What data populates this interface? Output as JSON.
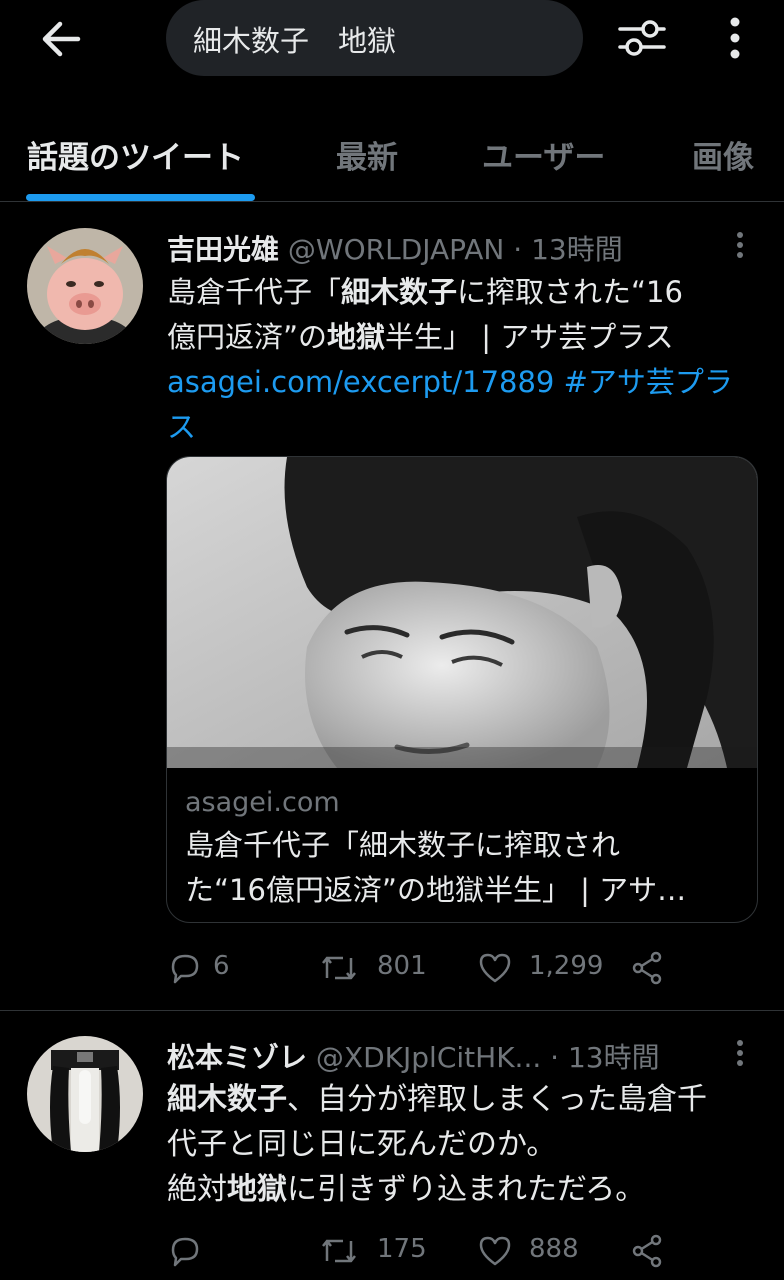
{
  "search": {
    "query": "細木数子　地獄"
  },
  "tabs": [
    {
      "label": "話題のツイート"
    },
    {
      "label": "最新"
    },
    {
      "label": "ユーザー"
    },
    {
      "label": "画像"
    }
  ],
  "tweets": [
    {
      "name": "吉田光雄",
      "handle": "@WORLDJAPAN",
      "time": "· 13時間",
      "text_1a": "島倉千代子「",
      "text_1b": "細木数子",
      "text_1c": "に搾取された“16",
      "text_2a": "億円返済”の",
      "text_2b": "地獄",
      "text_2c": "半生」 | アサ芸プラス",
      "link": "asagei.com/excerpt/17889",
      "hashtag_a": " #アサ芸プラ",
      "hashtag_b": "ス",
      "card": {
        "domain": "asagei.com",
        "title_1": "島倉千代子「細木数子に搾取され",
        "title_2": "た“16億円返済”の地獄半生」 | アサ…"
      },
      "replies": "6",
      "retweets": "801",
      "likes": "1,299"
    },
    {
      "name": "松本ミゾレ",
      "handle": "@XDKJplCitHK...",
      "time": "· 13時間",
      "line_1a": "細木数子",
      "line_1b": "、自分が搾取しまくった島倉千",
      "line_2": "代子と同じ日に死んだのか。",
      "line_3a": "絶対",
      "line_3b": "地獄",
      "line_3c": "に引きずり込まれただろ。",
      "replies": "",
      "retweets": "175",
      "likes": "888"
    }
  ],
  "colors": {
    "accent": "#1d9bf0",
    "muted": "#71767b",
    "text": "#e7e9ea",
    "background": "#000000"
  }
}
